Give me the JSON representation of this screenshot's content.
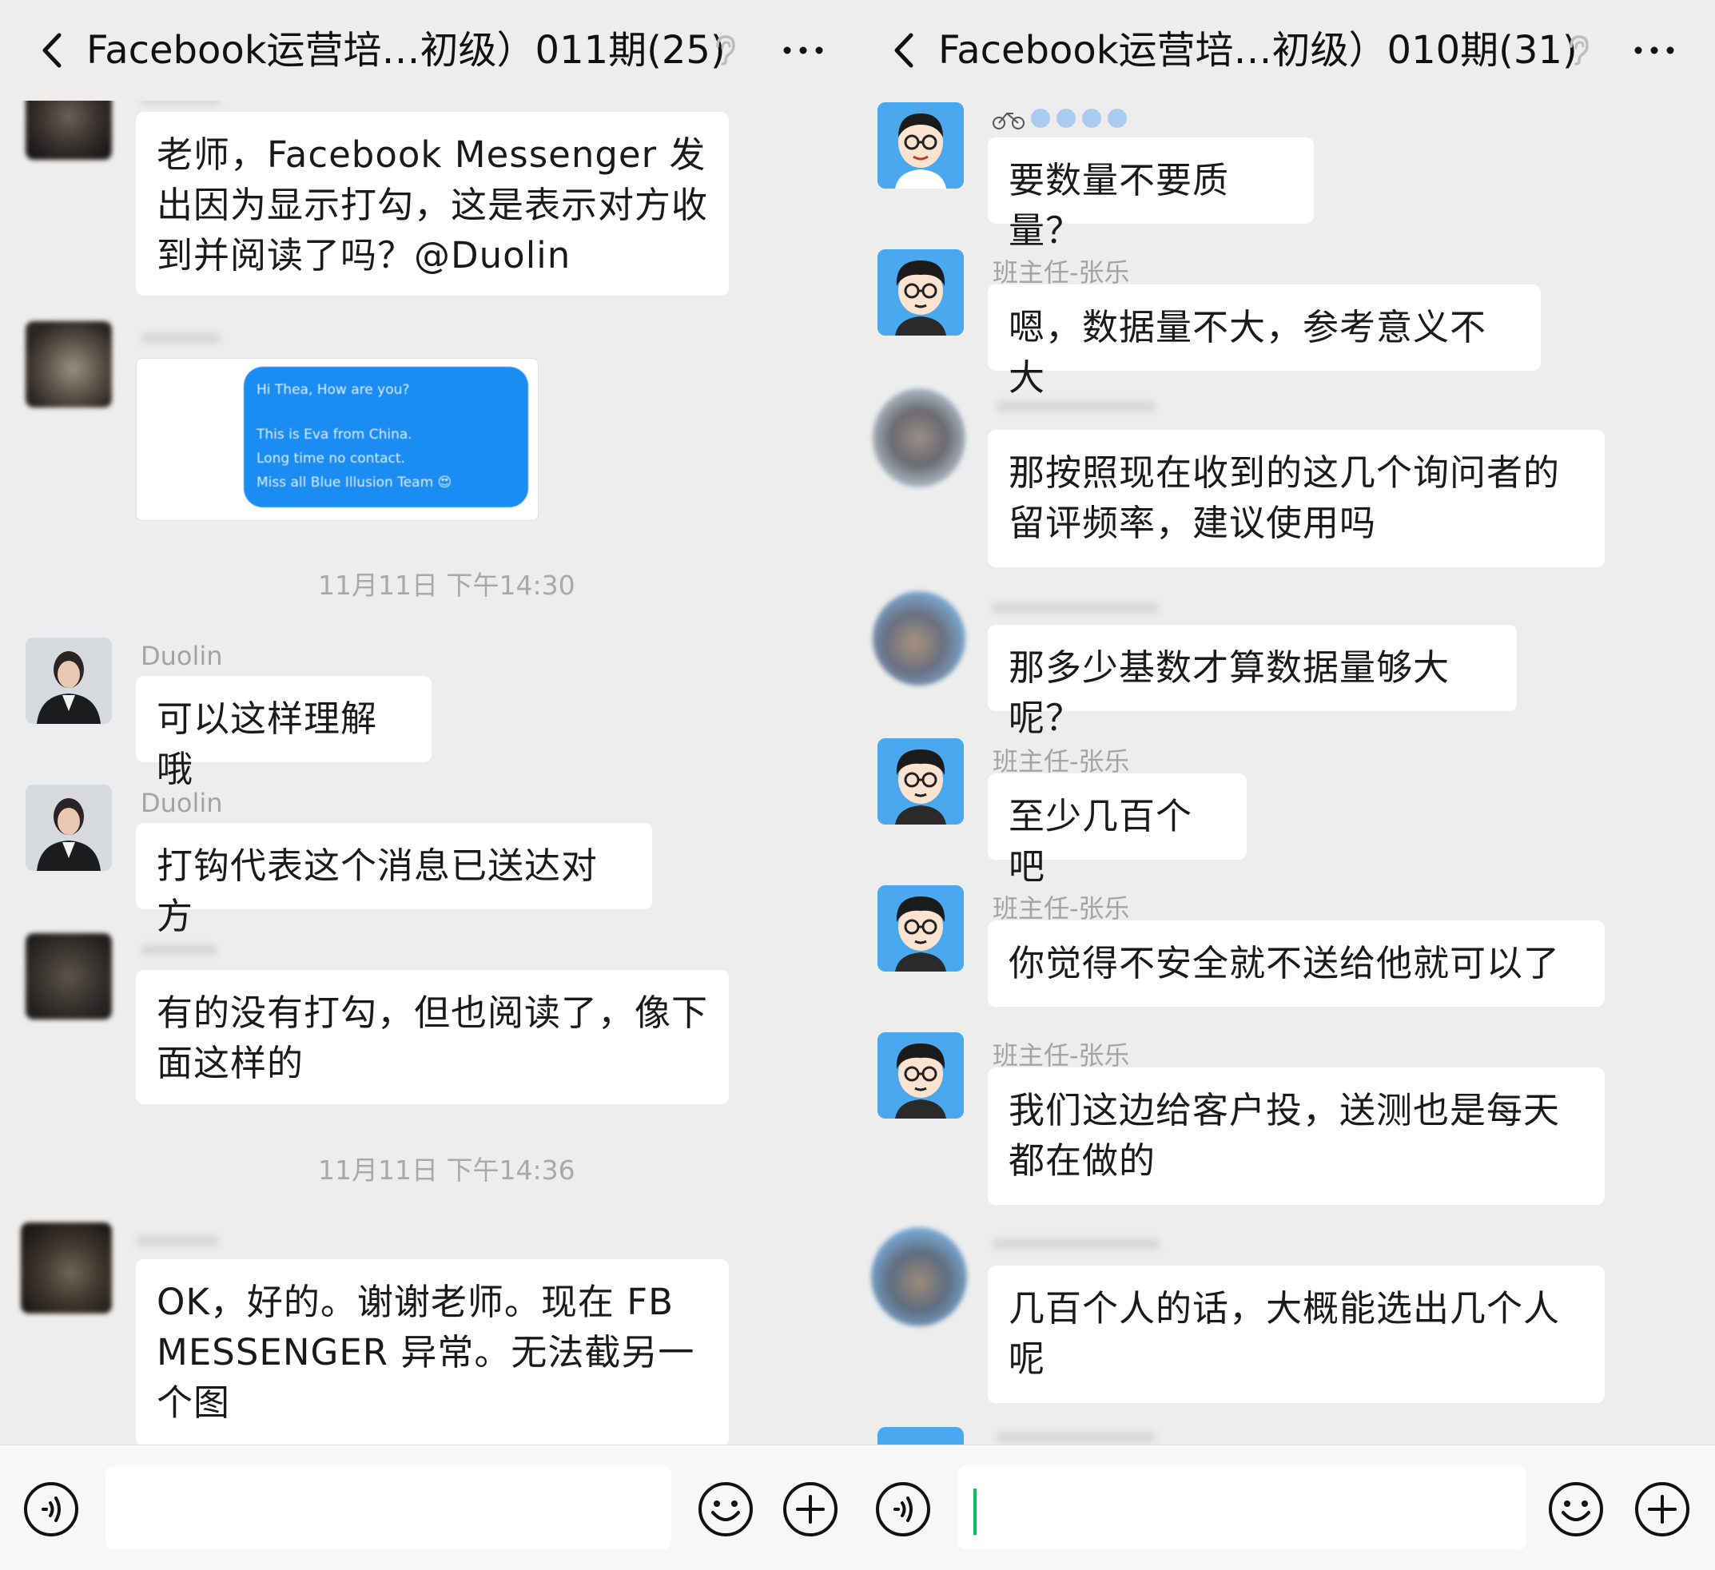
{
  "left": {
    "title": "Facebook运营培…初级）011期(25)",
    "messages": [
      {
        "text": "老师，Facebook Messenger 发出因为显示打勾，这是表示对方收到并阅读了吗？@Duolin"
      },
      {
        "image_lines": [
          "Hi Thea, How are you?",
          "This is Eva from China.",
          "Long time no contact.",
          "Miss all Blue Illusion Team 😍"
        ]
      },
      {
        "time": "11月11日 下午14:30"
      },
      {
        "name": "Duolin",
        "text": "可以这样理解哦"
      },
      {
        "name": "Duolin",
        "text": "打钩代表这个消息已送达对方"
      },
      {
        "text": "有的没有打勾，但也阅读了，像下面这样的"
      },
      {
        "time": "11月11日 下午14:36"
      },
      {
        "text": "OK，好的。谢谢老师。现在 FB MESSENGER 异常。无法截另一个图"
      }
    ]
  },
  "right": {
    "title": "Facebook运营培…初级）010期(31)",
    "messages": [
      {
        "text": "要数量不要质量？"
      },
      {
        "name": "班主任-张乐",
        "text": "嗯，数据量不大，参考意义不大"
      },
      {
        "text": "那按照现在收到的这几个询问者的留评频率，建议使用吗"
      },
      {
        "text": "那多少基数才算数据量够大呢？"
      },
      {
        "name": "班主任-张乐",
        "text": "至少几百个吧"
      },
      {
        "name": "班主任-张乐",
        "text": "你觉得不安全就不送给他就可以了"
      },
      {
        "name": "班主任-张乐",
        "text": "我们这边给客户投，送测也是每天都在做的"
      },
      {
        "text": "几百个人的话，大概能选出几个人呢"
      }
    ]
  },
  "icons": {
    "back": "chevron-left-icon",
    "ear": "ear-icon",
    "more": "more-icon",
    "voice": "voice-icon",
    "emoji": "emoji-icon",
    "plus": "plus-icon"
  },
  "colors": {
    "background": "#ededed",
    "bubble": "#ffffff",
    "image_bubble": "#1a8cf2",
    "cursor": "#07c160",
    "avatar_blue": "#4aa8ee"
  }
}
